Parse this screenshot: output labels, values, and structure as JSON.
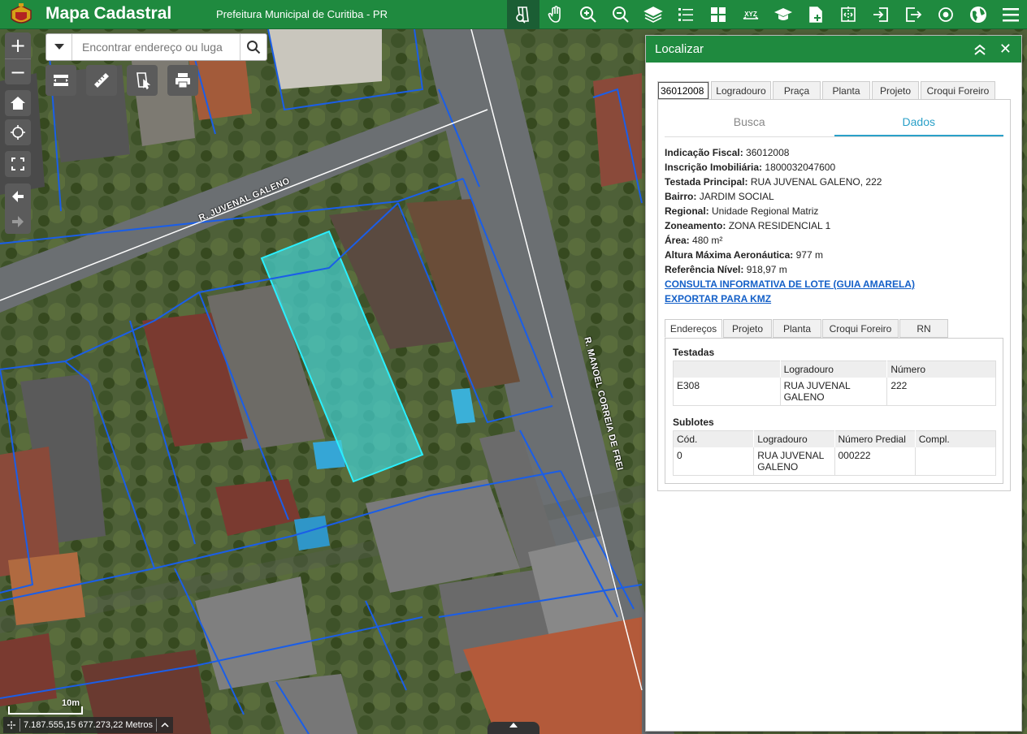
{
  "header": {
    "title": "Mapa Cadastral",
    "subtitle": "Prefeitura Municipal de Curitiba - PR",
    "brand_color": "#1f8a3f",
    "tools": [
      "identify-icon",
      "pan-icon",
      "zoom-in-icon",
      "zoom-out-icon",
      "layers-icon",
      "legend-icon",
      "basemap-icon",
      "xyz-icon",
      "education-icon",
      "add-data-icon",
      "compare-icon",
      "import-icon",
      "export-icon",
      "locate-icon",
      "world-map-icon",
      "menu-icon"
    ],
    "xyz_label": "XYZ"
  },
  "search": {
    "placeholder": "Encontrar endereço ou luga"
  },
  "map": {
    "streets": [
      "R. JUVENAL GALENO",
      "R. MANOEL CORREIA DE FREI"
    ],
    "scale_label": "10m",
    "coordinates": "7.187.555,15 677.273,22 Metros"
  },
  "panel": {
    "title": "Localizar",
    "tabs": {
      "input_value": "36012008",
      "items": [
        "Logradouro",
        "Praça",
        "Planta",
        "Projeto",
        "Croqui Foreiro"
      ]
    },
    "subtabs": [
      "Busca",
      "Dados"
    ],
    "info": [
      {
        "label": "Indicação Fiscal:",
        "value": "36012008"
      },
      {
        "label": "Inscrição Imobiliária:",
        "value": "1800032047600"
      },
      {
        "label": "Testada Principal:",
        "value": "RUA JUVENAL GALENO, 222"
      },
      {
        "label": "Bairro:",
        "value": "JARDIM SOCIAL"
      },
      {
        "label": "Regional:",
        "value": "Unidade Regional Matriz"
      },
      {
        "label": "Zoneamento:",
        "value": "ZONA RESIDENCIAL 1"
      },
      {
        "label": "Área:",
        "value": "480 m²"
      },
      {
        "label": "Altura Máxima Aeronáutica:",
        "value": "977 m"
      },
      {
        "label": "Referência Nível:",
        "value": "918,97 m"
      }
    ],
    "links": [
      "CONSULTA INFORMATIVA DE LOTE (GUIA AMARELA)",
      "EXPORTAR PARA KMZ"
    ],
    "detail_tabs": [
      "Endereços",
      "Projeto",
      "Planta",
      "Croqui Foreiro",
      "RN"
    ],
    "testadas": {
      "title": "Testadas",
      "headers": [
        "Logradouro",
        "Número"
      ],
      "rows": [
        [
          "E308",
          "RUA JUVENAL GALENO",
          "222"
        ]
      ]
    },
    "sublotes": {
      "title": "Sublotes",
      "headers": [
        "Cód.",
        "Logradouro",
        "Número Predial",
        "Compl."
      ],
      "rows": [
        [
          "0",
          "RUA JUVENAL GALENO",
          "000222",
          ""
        ]
      ]
    }
  }
}
